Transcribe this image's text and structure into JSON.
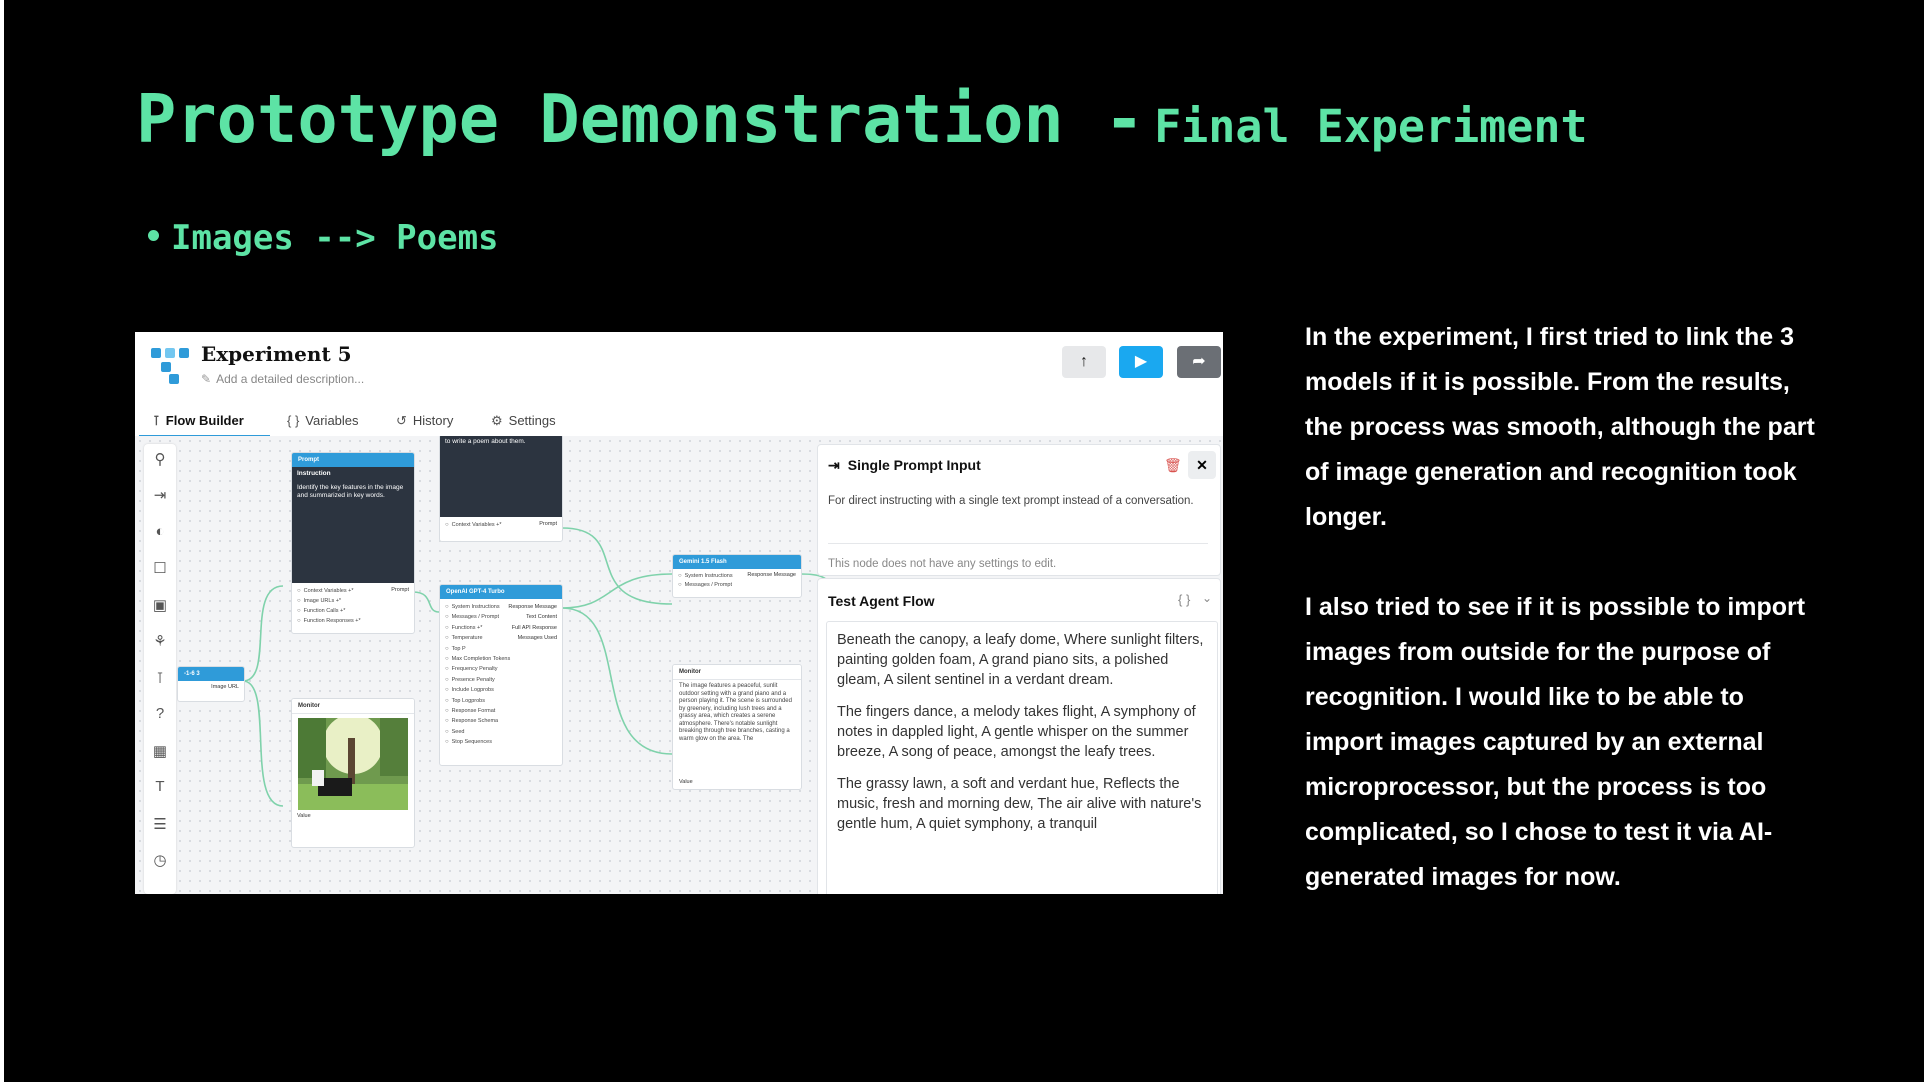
{
  "slide": {
    "title_main": "Prototype Demonstration -",
    "title_sub": "Final Experiment",
    "bullet": "Images --> Poems",
    "paragraph_1": "In the experiment, I first tried to link the 3 models if it is possible. From the results, the process was smooth, although the part of image generation and recognition took longer.",
    "paragraph_2": "I also tried to see if it is possible to import images from outside for the purpose of recognition. I would like to be able to import images captured by an external microprocessor, but the process is too complicated, so I chose to test it via AI-generated images for now.",
    "colors": {
      "background": "#000000",
      "accent": "#5de3a5",
      "text": "#ffffff"
    }
  },
  "app": {
    "title": "Experiment 5",
    "description_placeholder": "Add a detailed description...",
    "toolbar": {
      "upload_icon": "arrow-up-icon",
      "run_icon": "play-icon",
      "share_icon": "share-icon"
    },
    "tabs": [
      {
        "label": "Flow Builder",
        "icon": "flow-icon",
        "active": true
      },
      {
        "label": "Variables",
        "icon": "braces-icon"
      },
      {
        "label": "History",
        "icon": "history-icon"
      },
      {
        "label": "Settings",
        "icon": "gear-icon"
      }
    ],
    "nodes": {
      "prompt_top": {
        "text": "to write a poem about them.",
        "port": "Context Variables +*",
        "out": "Prompt"
      },
      "prompt": {
        "title": "Prompt",
        "header": "Instruction",
        "text": "Identify the key features in the image and summarized in key words.",
        "ports": [
          "Context Variables +*",
          "Image URLs +*",
          "Function Calls +*",
          "Function Responses +*"
        ],
        "out": "Prompt"
      },
      "input": {
        "title": "-1-6 3",
        "port": "Image URL"
      },
      "openai": {
        "title": "OpenAI GPT-4 Turbo",
        "ports": [
          "System Instructions",
          "Messages / Prompt",
          "Functions +*",
          "Temperature",
          "Top P",
          "Max Completion Tokens",
          "Frequency Penalty",
          "Presence Penalty",
          "Include Logprobs",
          "Top Logprobs",
          "Response Format",
          "Response Schema",
          "Seed",
          "Stop Sequences"
        ],
        "outs": [
          "Response Message",
          "Text Content",
          "Full API Response",
          "Messages Used"
        ]
      },
      "gemini": {
        "title": "Gemini 1.5 Flash",
        "ports": [
          "System Instructions",
          "Messages / Prompt"
        ],
        "out": "Response Message"
      },
      "monitor_image": {
        "title": "Monitor",
        "port": "Value"
      },
      "monitor_text": {
        "title": "Monitor",
        "text": "The image features a peaceful, sunlit outdoor setting with a grand piano and a person playing it. The scene is surrounded by greenery, including lush trees and a grassy area, which creates a serene atmosphere. There's notable sunlight breaking through tree branches, casting a warm glow on the area. The",
        "port": "Value"
      }
    },
    "single_prompt": {
      "title": "Single Prompt Input",
      "description": "For direct instructing with a single text prompt instead of a conversation.",
      "note": "This node does not have any settings to edit."
    },
    "test_flow": {
      "title": "Test Agent Flow",
      "poems": [
        "Beneath the canopy, a leafy dome, Where sunlight filters, painting golden foam, A grand piano sits, a polished gleam, A silent sentinel in a verdant dream.",
        "The fingers dance, a melody takes flight, A symphony of notes in dappled light, A gentle whisper on the summer breeze, A song of peace, amongst the leafy trees.",
        "The grassy lawn, a soft and verdant hue, Reflects the music, fresh and morning dew, The air alive with nature's gentle hum, A quiet symphony, a tranquil"
      ]
    }
  }
}
